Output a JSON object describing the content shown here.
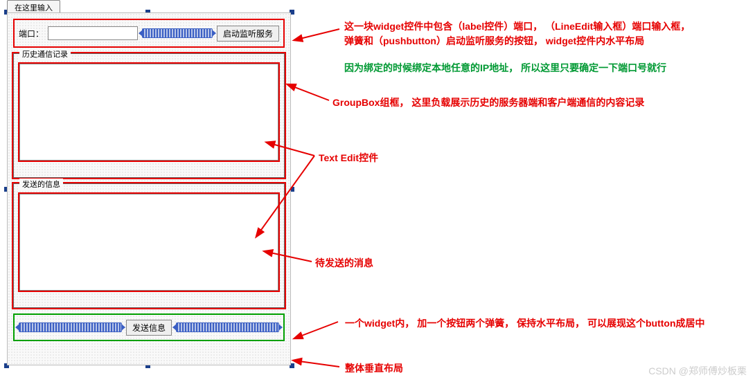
{
  "tab_label": "在这里输入",
  "port": {
    "label": "端口：",
    "value": "",
    "start_button": "启动监听服务"
  },
  "groupboxes": {
    "history_title": "历史通信记录",
    "send_title": "发送的信息"
  },
  "send_button": "发送信息",
  "annotations": {
    "top1": "这一块widget控件中包含（label控件）端口，  （LineEdit输入框）端口输入框，",
    "top2": "弹簧和（pushbutton）启动监听服务的按钮， widget控件内水平布局",
    "ip_note": "因为绑定的时候绑定本地任意的IP地址，  所以这里只要确定一下端口号就行",
    "groupbox_note": "GroupBox组框， 这里负载展示历史的服务器端和客户端通信的内容记录",
    "textedit_note": "Text Edit控件",
    "pending_msg": "待发送的消息",
    "widget_note": "一个widget内， 加一个按钮两个弹簧， 保持水平布局， 可以展现这个button成居中",
    "layout_note": "整体垂直布局"
  },
  "watermark": "CSDN @郑师傅炒板栗"
}
